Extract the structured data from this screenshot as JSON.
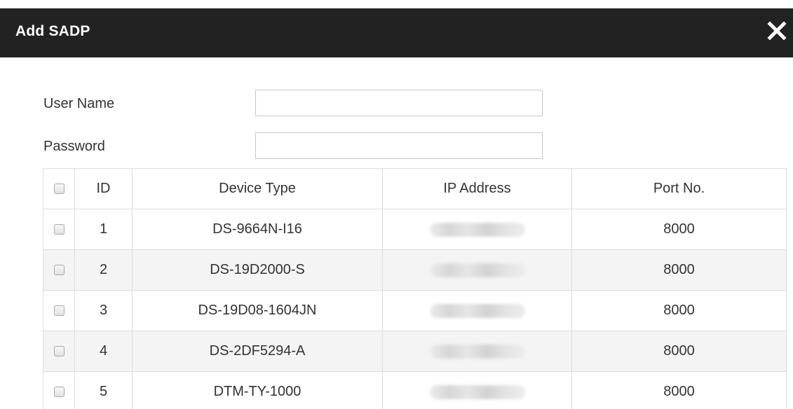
{
  "dialog": {
    "title": "Add SADP",
    "close_icon": "close-icon"
  },
  "form": {
    "username_label": "User Name",
    "username_value": "",
    "password_label": "Password",
    "password_value": ""
  },
  "table": {
    "headers": {
      "id": "ID",
      "device_type": "Device Type",
      "ip_address": "IP Address",
      "port": "Port No."
    },
    "rows": [
      {
        "id": "1",
        "device_type": "DS-9664N-I16",
        "ip_address": "",
        "port": "8000"
      },
      {
        "id": "2",
        "device_type": "DS-19D2000-S",
        "ip_address": "",
        "port": "8000"
      },
      {
        "id": "3",
        "device_type": "DS-19D08-1604JN",
        "ip_address": "",
        "port": "8000"
      },
      {
        "id": "4",
        "device_type": "DS-2DF5294-A",
        "ip_address": "",
        "port": "8000"
      },
      {
        "id": "5",
        "device_type": "DTM-TY-1000",
        "ip_address": "",
        "port": "8000"
      }
    ]
  },
  "colors": {
    "titlebar": "#222222",
    "title_text": "#ffffff",
    "row_alt": "#f4f4f4",
    "border": "#dddddd"
  }
}
